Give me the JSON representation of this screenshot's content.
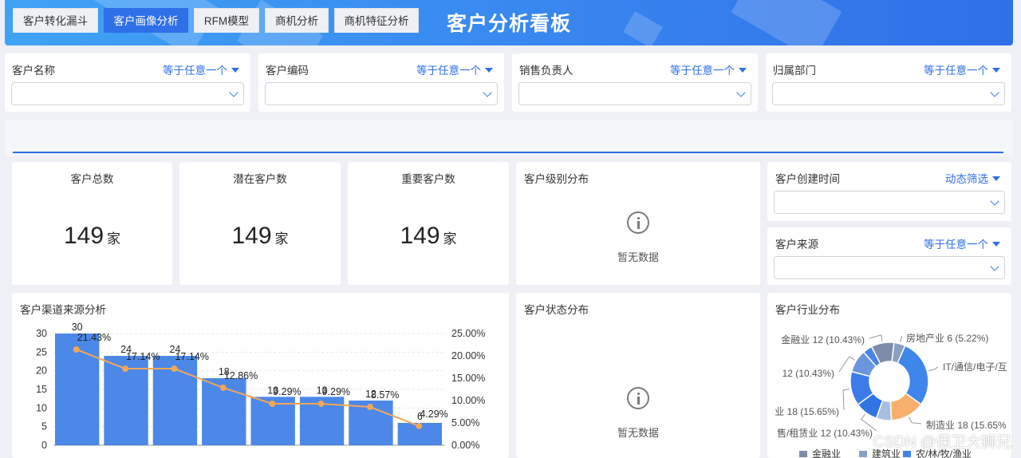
{
  "header": {
    "title": "客户分析看板"
  },
  "filters": [
    {
      "label": "客户名称",
      "op": "等于任意一个"
    },
    {
      "label": "客户编码",
      "op": "等于任意一个"
    },
    {
      "label": "销售负责人",
      "op": "等于任意一个"
    },
    {
      "label": "归属部门",
      "op": "等于任意一个"
    }
  ],
  "tabs": [
    {
      "label": "客户转化漏斗",
      "active": false
    },
    {
      "label": "客户画像分析",
      "active": true
    },
    {
      "label": "RFM模型",
      "active": false
    },
    {
      "label": "商机分析",
      "active": false
    },
    {
      "label": "商机特征分析",
      "active": false
    }
  ],
  "kpis": [
    {
      "title": "客户总数",
      "value": "149",
      "unit": "家"
    },
    {
      "title": "潜在客户数",
      "value": "149",
      "unit": "家"
    },
    {
      "title": "重要客户数",
      "value": "149",
      "unit": "家"
    }
  ],
  "level_panel": {
    "title": "客户级别分布",
    "empty": "暂无数据"
  },
  "status_panel": {
    "title": "客户状态分布",
    "empty": "暂无数据"
  },
  "side_filters": [
    {
      "label": "客户创建时间",
      "op": "动态筛选"
    },
    {
      "label": "客户来源",
      "op": "等于任意一个"
    }
  ],
  "channel_panel": {
    "title": "客户渠道来源分析"
  },
  "industry_panel": {
    "title": "客户行业分布"
  },
  "colors": {
    "accent": "#2f6fe8",
    "bar": "#3d7ee6",
    "line": "#f2a65a"
  },
  "watermark": "CSDN @保卫大狮兄",
  "chart_data": [
    {
      "type": "bar",
      "title": "客户渠道来源分析",
      "series": [
        {
          "values": [
            30,
            24,
            24,
            18,
            13,
            13,
            12,
            6
          ]
        },
        {
          "type": "line",
          "values": [
            21.43,
            17.14,
            17.14,
            12.86,
            9.29,
            9.29,
            8.57,
            4.29
          ],
          "labels": [
            "21.43%",
            "17.14%",
            "17.14%",
            "12.86%",
            "9.29%",
            "9.29%",
            "8.57%",
            "4.29%"
          ]
        }
      ],
      "ylim": [
        0,
        30
      ],
      "yticks": [
        "0",
        "5",
        "10",
        "15",
        "20",
        "25",
        "30"
      ],
      "y2lim": [
        0,
        25
      ],
      "y2ticks": [
        "0.00%",
        "5.00%",
        "10.00%",
        "15.00%",
        "20.00%",
        "25.00%"
      ],
      "grid": true
    },
    {
      "type": "pie",
      "title": "客户行业分布",
      "slices": [
        {
          "label": "房地产业 6 (5.22%)",
          "value": 6,
          "color": "#8a9fc4"
        },
        {
          "label": "IT/通信/电子/互",
          "value": 36,
          "color": "#3f86ea"
        },
        {
          "label": "制造业 18 (15.65%",
          "value": 18,
          "color": "#f7b06b"
        },
        {
          "label": "",
          "value": 8,
          "color": "#a9bfe0"
        },
        {
          "label": "售/租赁业 12 (10.43%)",
          "value": 12,
          "color": "#2f75e3"
        },
        {
          "label": "业 18 (15.65%)",
          "value": 18,
          "color": "#3b7cea"
        },
        {
          "label": "12 (10.43%)",
          "value": 12,
          "color": "#6b95dd"
        },
        {
          "label": "",
          "value": 5,
          "color": "#4a84e6"
        },
        {
          "label": "金融业 12 (10.43%)",
          "value": 12,
          "color": "#7d8ca8"
        }
      ],
      "legend": [
        "金融业",
        "建筑业",
        "农/林/牧/渔业"
      ]
    }
  ]
}
